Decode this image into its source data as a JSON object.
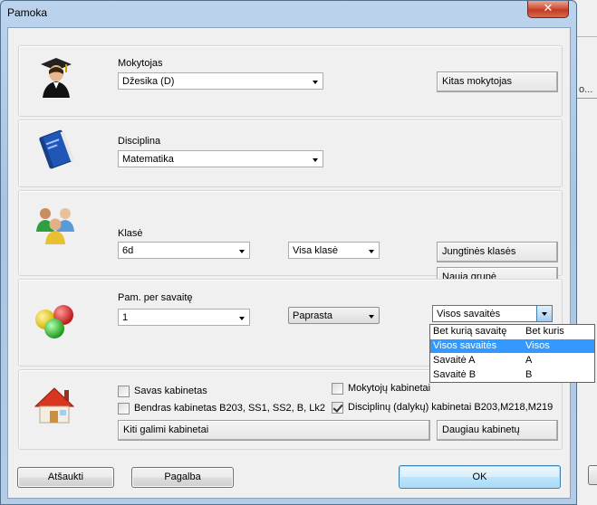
{
  "window": {
    "title": "Pamoka",
    "close_glyph": "✕"
  },
  "background_app": {
    "fragment": "o..."
  },
  "teacher": {
    "label": "Mokytojas",
    "value": "Džesika (D)",
    "button": "Kitas mokytojas",
    "icon": "graduate-teacher-icon"
  },
  "discipline": {
    "label": "Disciplina",
    "value": "Matematika",
    "icon": "book-icon"
  },
  "class": {
    "label": "Klasė",
    "value": "6d",
    "scope_value": "Visa klasė",
    "joint_button": "Jungtinės klasės",
    "new_group_button": "Nauja grupė",
    "icon": "students-group-icon"
  },
  "lessons": {
    "label": "Pam. per savaitę",
    "count_value": "1",
    "mode_value": "Paprasta",
    "week_value": "Visos savaitės",
    "icon": "balls-icon",
    "week_options": [
      {
        "label": "Bet kurią savaitę",
        "code": "Bet kuris",
        "selected": false
      },
      {
        "label": "Visos savaitės",
        "code": "Visos",
        "selected": true
      },
      {
        "label": "Savaitė A",
        "code": "A",
        "selected": false
      },
      {
        "label": "Savaitė B",
        "code": "B",
        "selected": false
      }
    ]
  },
  "rooms": {
    "icon": "house-icon",
    "own_room": {
      "label": "Savas kabinetas",
      "checked": false
    },
    "shared_room": {
      "label": "Bendras kabinetas B203, SS1, SS2, B, Lk2",
      "checked": false
    },
    "teacher_rooms": {
      "label": "Mokytojų kabinetai",
      "checked": false
    },
    "discipline_rooms": {
      "label": "Disciplinų (dalykų) kabinetai B203,M218,M219",
      "checked": true
    },
    "other_button": "Kiti galimi kabinetai",
    "more_button": "Daugiau kabinetų"
  },
  "footer": {
    "cancel": "Atšaukti",
    "help": "Pagalba",
    "ok": "OK"
  },
  "colors": {
    "selection": "#3399ff",
    "close_red": "#c33a22",
    "frame_blue": "#a9c4e2"
  }
}
